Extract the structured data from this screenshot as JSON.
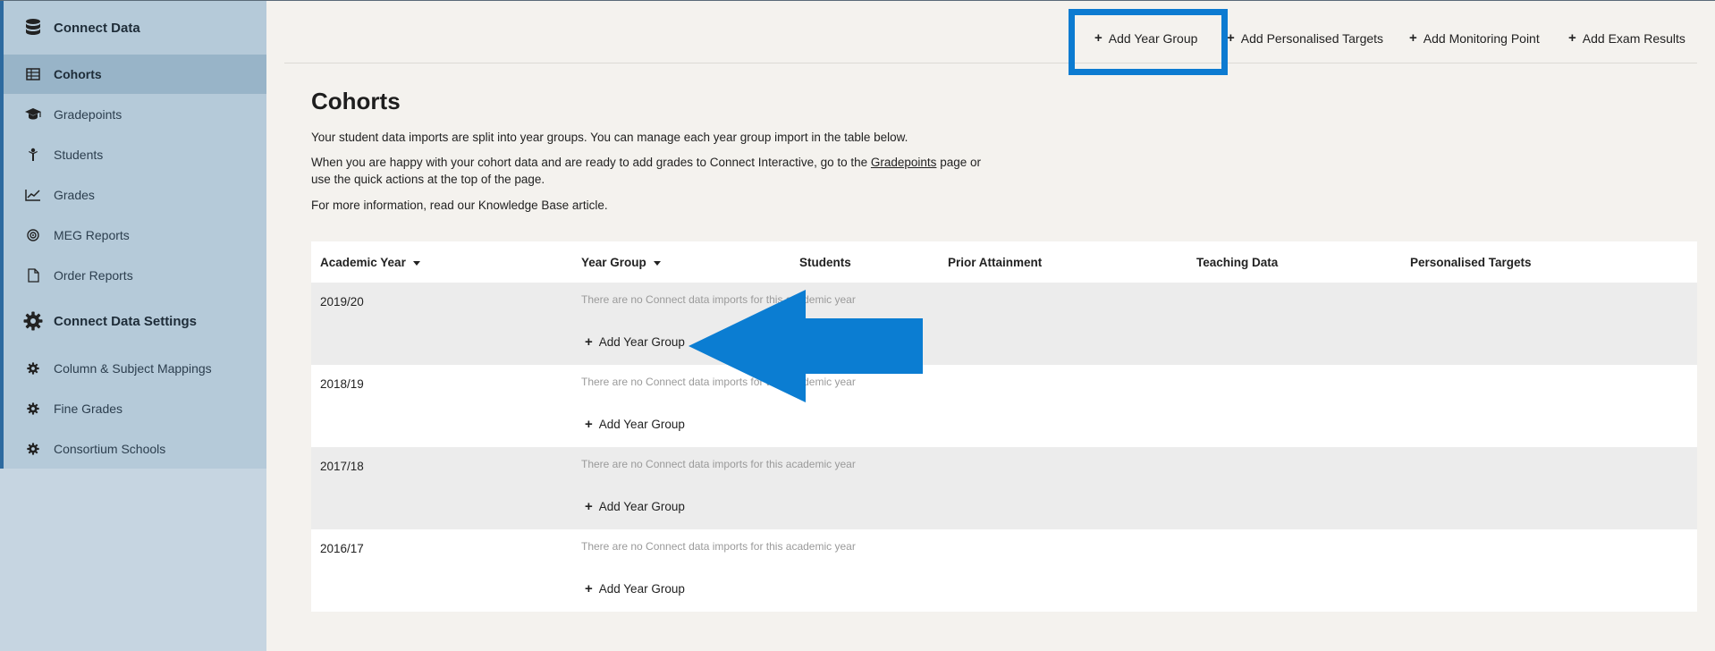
{
  "sidebar": {
    "items": [
      {
        "label": "Connect Data",
        "icon": "database-icon"
      },
      {
        "label": "Cohorts",
        "icon": "table-icon"
      },
      {
        "label": "Gradepoints",
        "icon": "graduation-cap-icon"
      },
      {
        "label": "Students",
        "icon": "student-icon"
      },
      {
        "label": "Grades",
        "icon": "line-chart-icon"
      },
      {
        "label": "MEG Reports",
        "icon": "target-icon"
      },
      {
        "label": "Order Reports",
        "icon": "document-icon"
      },
      {
        "label": "Connect Data Settings",
        "icon": "gear-icon"
      },
      {
        "label": "Column & Subject Mappings",
        "icon": "gear-icon"
      },
      {
        "label": "Fine Grades",
        "icon": "gear-icon"
      },
      {
        "label": "Consortium Schools",
        "icon": "gear-icon"
      }
    ],
    "active": "Cohorts"
  },
  "topbar": {
    "actions": [
      {
        "label": "Add Year Group"
      },
      {
        "label": "Add Personalised Targets"
      },
      {
        "label": "Add Monitoring Point"
      },
      {
        "label": "Add Exam Results"
      }
    ]
  },
  "main": {
    "title": "Cohorts",
    "intro": "Your student data imports are split into year groups. You can manage each year group import in the table below.",
    "para2_before": "When you are happy with your cohort data and are ready to add grades to Connect Interactive, go to the ",
    "para2_link": "Gradepoints",
    "para2_after": " page or",
    "para2_line2": "use the quick actions at the top of the page.",
    "para3": "For more information, read our Knowledge Base article."
  },
  "table": {
    "columns": [
      "Academic Year",
      "Year Group",
      "Students",
      "Prior Attainment",
      "Teaching Data",
      "Personalised Targets"
    ],
    "rows": [
      {
        "year": "2019/20",
        "note": "There are no Connect data imports for this academic year",
        "action": "Add Year Group"
      },
      {
        "year": "2018/19",
        "note": "There are no Connect data imports for this academic year",
        "action": "Add Year Group"
      },
      {
        "year": "2017/18",
        "note": "There are no Connect data imports for this academic year",
        "action": "Add Year Group"
      },
      {
        "year": "2016/17",
        "note": "There are no Connect data imports for this academic year",
        "action": "Add Year Group"
      }
    ]
  },
  "colors": {
    "highlight": "#0c7bd1",
    "sidebar_bg": "#b5cad9",
    "sidebar_active": "#98b4c8",
    "page_bg": "#f4f2ee"
  }
}
